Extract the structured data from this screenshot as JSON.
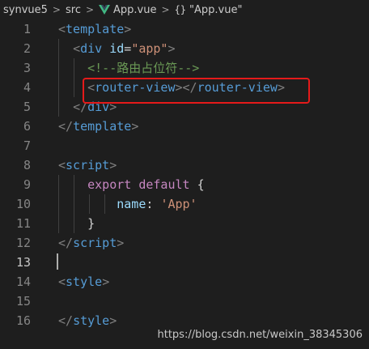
{
  "breadcrumb": {
    "items": [
      "synvue5",
      "src",
      "App.vue",
      "\"App.vue\""
    ],
    "separator": ">",
    "icons": [
      "vue-icon",
      "braces-icon"
    ]
  },
  "editor": {
    "active_line": 13,
    "line_numbers": [
      "1",
      "2",
      "3",
      "4",
      "5",
      "6",
      "7",
      "8",
      "9",
      "10",
      "11",
      "12",
      "13",
      "14",
      "15",
      "16"
    ],
    "lines": [
      [
        {
          "t": "punct",
          "v": "<"
        },
        {
          "t": "tag",
          "v": "template"
        },
        {
          "t": "punct",
          "v": ">"
        }
      ],
      [
        {
          "t": "plain",
          "v": "  "
        },
        {
          "t": "punct",
          "v": "<"
        },
        {
          "t": "tag",
          "v": "div"
        },
        {
          "t": "plain",
          "v": " "
        },
        {
          "t": "attr",
          "v": "id"
        },
        {
          "t": "plain",
          "v": "="
        },
        {
          "t": "str",
          "v": "\"app\""
        },
        {
          "t": "punct",
          "v": ">"
        }
      ],
      [
        {
          "t": "plain",
          "v": "    "
        },
        {
          "t": "cmt",
          "v": "<!--路由占位符-->"
        }
      ],
      [
        {
          "t": "plain",
          "v": "    "
        },
        {
          "t": "punct",
          "v": "<"
        },
        {
          "t": "tag",
          "v": "router-view"
        },
        {
          "t": "punct",
          "v": "></"
        },
        {
          "t": "tag",
          "v": "router-view"
        },
        {
          "t": "punct",
          "v": ">"
        }
      ],
      [
        {
          "t": "plain",
          "v": "  "
        },
        {
          "t": "punct",
          "v": "</"
        },
        {
          "t": "tag",
          "v": "div"
        },
        {
          "t": "punct",
          "v": ">"
        }
      ],
      [
        {
          "t": "punct",
          "v": "</"
        },
        {
          "t": "tag",
          "v": "template"
        },
        {
          "t": "punct",
          "v": ">"
        }
      ],
      [],
      [
        {
          "t": "punct",
          "v": "<"
        },
        {
          "t": "tag",
          "v": "script"
        },
        {
          "t": "punct",
          "v": ">"
        }
      ],
      [
        {
          "t": "plain",
          "v": "    "
        },
        {
          "t": "kw",
          "v": "export"
        },
        {
          "t": "plain",
          "v": " "
        },
        {
          "t": "kw",
          "v": "default"
        },
        {
          "t": "plain",
          "v": " {"
        }
      ],
      [
        {
          "t": "plain",
          "v": "        "
        },
        {
          "t": "prop",
          "v": "name"
        },
        {
          "t": "plain",
          "v": ": "
        },
        {
          "t": "str",
          "v": "'App'"
        }
      ],
      [
        {
          "t": "plain",
          "v": "    }"
        }
      ],
      [
        {
          "t": "punct",
          "v": "</"
        },
        {
          "t": "tag",
          "v": "script"
        },
        {
          "t": "punct",
          "v": ">"
        }
      ],
      [],
      [
        {
          "t": "punct",
          "v": "<"
        },
        {
          "t": "tag",
          "v": "style"
        },
        {
          "t": "punct",
          "v": ">"
        }
      ],
      [],
      [
        {
          "t": "punct",
          "v": "</"
        },
        {
          "t": "tag",
          "v": "style"
        },
        {
          "t": "punct",
          "v": ">"
        }
      ]
    ]
  },
  "annotation": {
    "color": "#e51a1a",
    "target_line": 4
  },
  "watermark": "https://blog.csdn.net/weixin_38345306",
  "colors": {
    "background": "#1e1e1e",
    "tag": "#569cd6",
    "punct": "#808080",
    "attr": "#9cdcfe",
    "string": "#ce9178",
    "comment": "#6a9955",
    "keyword": "#c586c0",
    "vue_green": "#41b883"
  }
}
